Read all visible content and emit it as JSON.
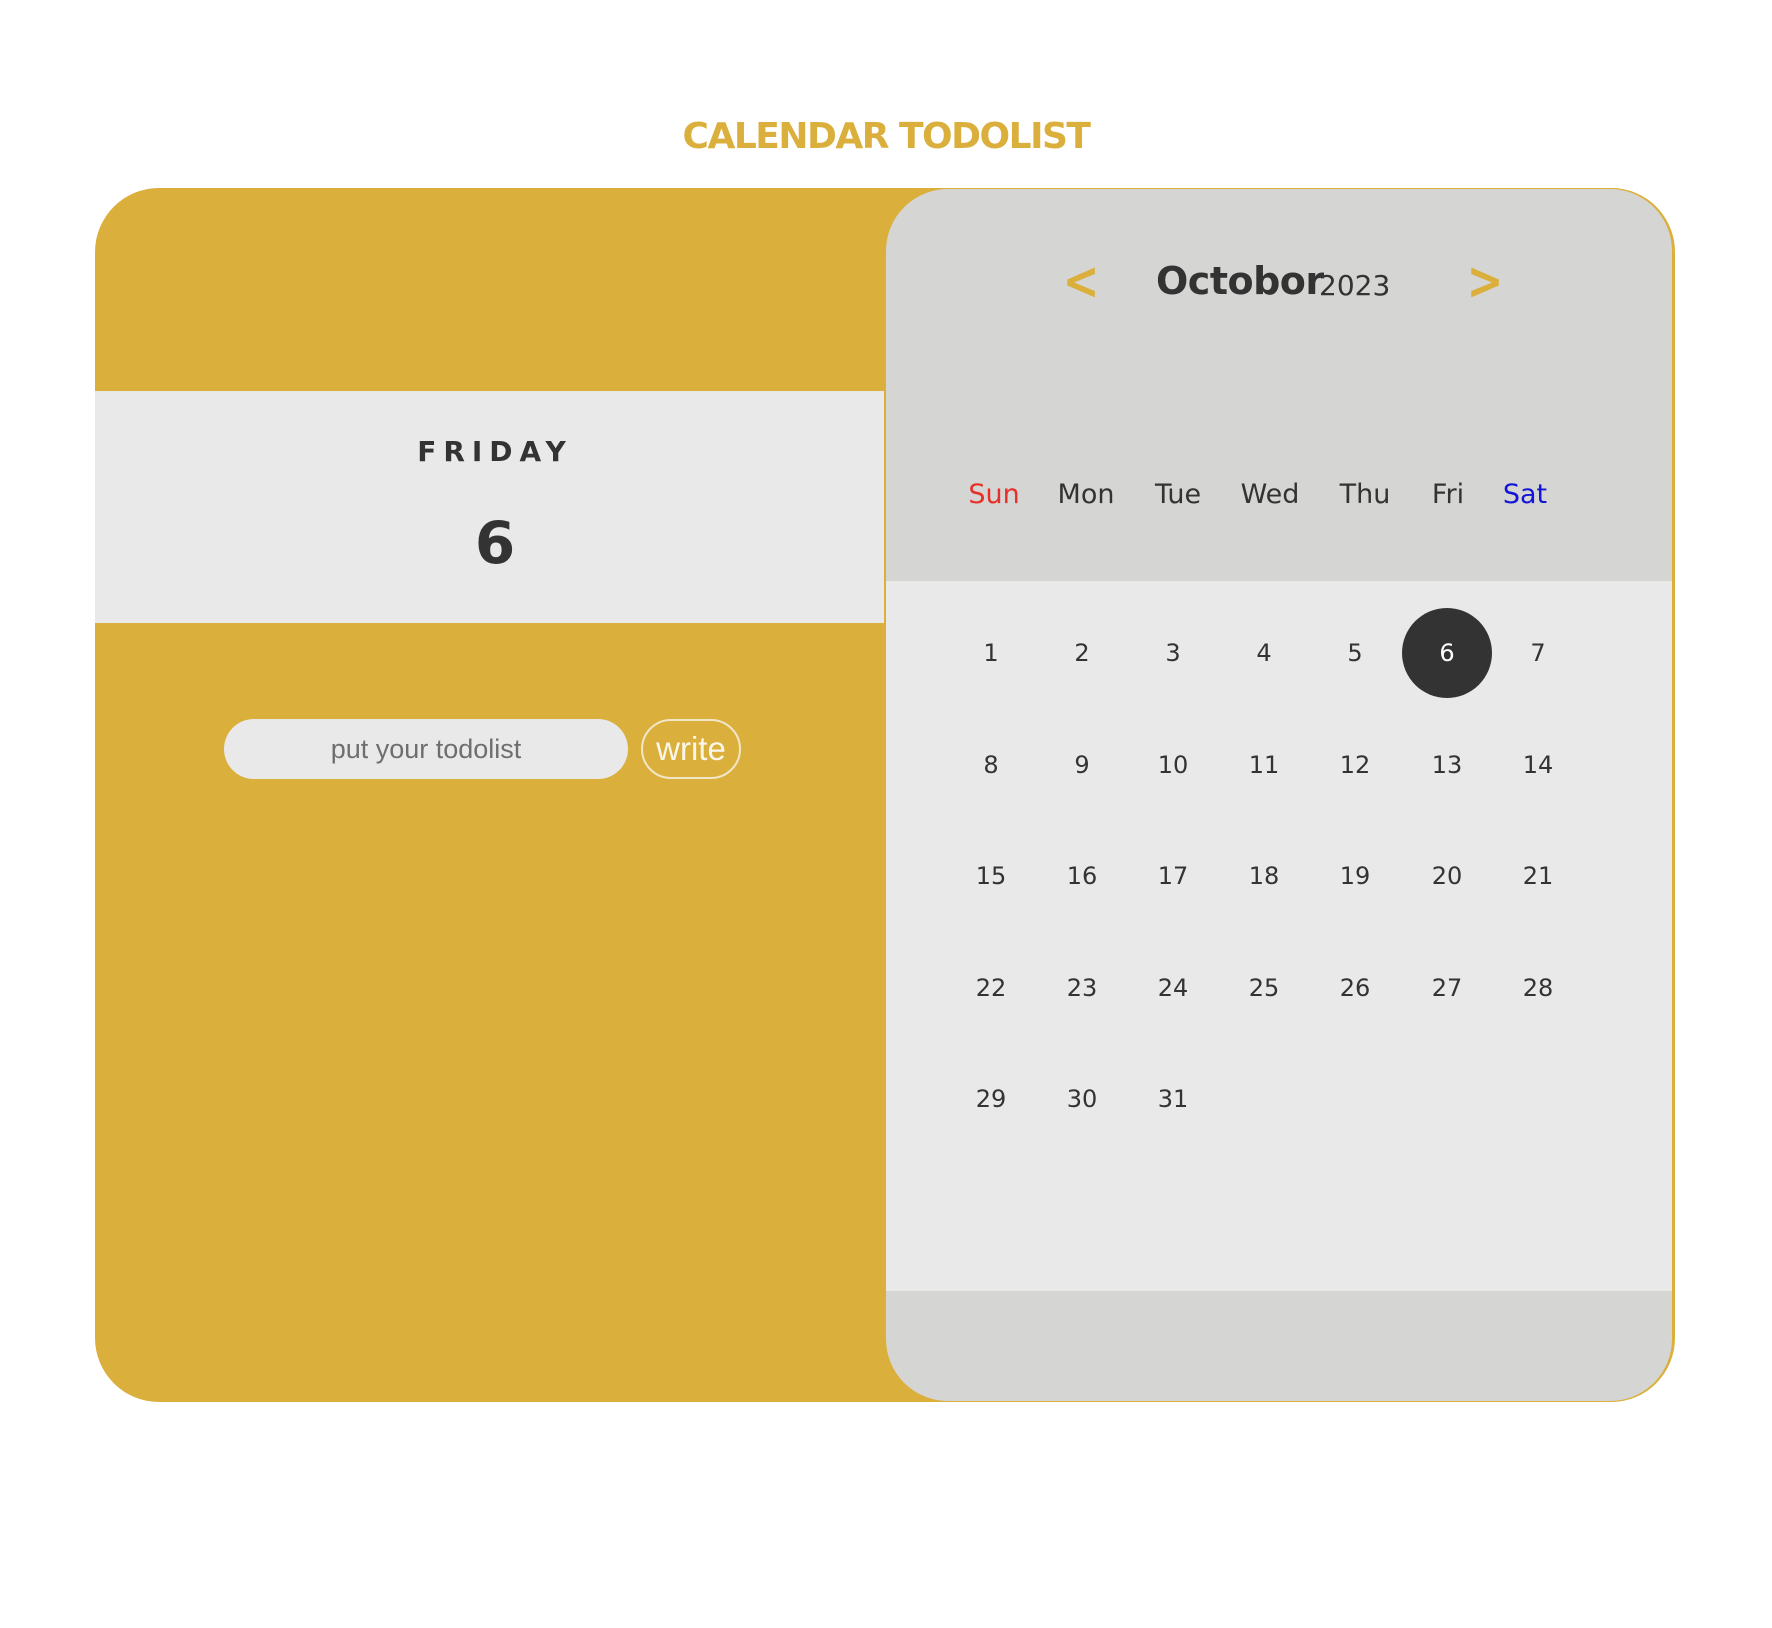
{
  "page": {
    "title": "CALENDAR TODOLIST"
  },
  "colors": {
    "accent": "#dbaf3b",
    "panel_light": "#e9e9e9",
    "calendar_gray": "#d5d5d3",
    "text_dark": "#333333",
    "sunday": "#e8302a",
    "saturday": "#1414d6"
  },
  "selected_day": {
    "weekday": "FRIDAY",
    "day": "6"
  },
  "todo": {
    "input_placeholder": "put your todolist",
    "input_value": "",
    "write_label": "write"
  },
  "calendar": {
    "prev_label": "<",
    "next_label": ">",
    "prev_icon": "chevron-left-icon",
    "next_icon": "chevron-right-icon",
    "month": "Octobor",
    "year": "2023",
    "weekdays": [
      "Sun",
      "Mon",
      "Tue",
      "Wed",
      "Thu",
      "Fri",
      "Sat"
    ],
    "first_weekday_index": 0,
    "days_in_month": 31,
    "selected_date": 6,
    "dates": [
      "1",
      "2",
      "3",
      "4",
      "5",
      "6",
      "7",
      "8",
      "9",
      "10",
      "11",
      "12",
      "13",
      "14",
      "15",
      "16",
      "17",
      "18",
      "19",
      "20",
      "21",
      "22",
      "23",
      "24",
      "25",
      "26",
      "27",
      "28",
      "29",
      "30",
      "31"
    ]
  }
}
